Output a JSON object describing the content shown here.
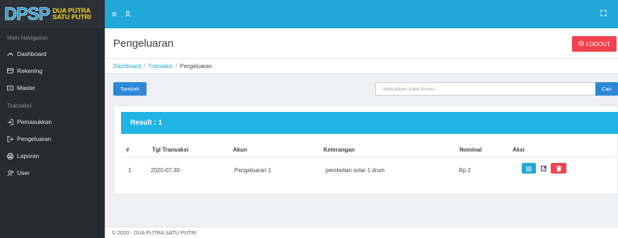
{
  "brand": {
    "logo_big": "DPSP",
    "logo_line1": "DUA PUTRA",
    "logo_line2": "SATU PUTRI"
  },
  "sidebar": {
    "header_main": "Main Navigation",
    "header_transaksi": "Transaksi",
    "items": [
      {
        "label": "Dashboard",
        "icon": "dashboard-icon"
      },
      {
        "label": "Rekening",
        "icon": "card-icon"
      },
      {
        "label": "Master",
        "icon": "folder-icon"
      },
      {
        "label": "Pemasukkan",
        "icon": "login-icon"
      },
      {
        "label": "Pengeluaran",
        "icon": "logout-icon"
      },
      {
        "label": "Laporan",
        "icon": "print-icon"
      },
      {
        "label": "User",
        "icon": "users-icon"
      }
    ]
  },
  "topbar": {
    "burger": "≡",
    "user_icon": "ꭺ",
    "expand_icon": "⛶"
  },
  "page": {
    "title": "Pengeluaran",
    "logout_label": "LOGOUT",
    "breadcrumb": [
      "Dashboard",
      "Transaksi",
      "Pengeluaran"
    ],
    "breadcrumb_sep": "/"
  },
  "toolbar": {
    "add_label": "Tambah",
    "search_placeholder": "Masukkan Kata Kunci...",
    "search_button": "Cari"
  },
  "result": {
    "title": "Result : 1",
    "columns": [
      "#",
      "Tgl Transaksi",
      "Akun",
      "Keterangan",
      "Nominal",
      "Aksi"
    ],
    "rows": [
      {
        "no": "1",
        "tgl": "2020-07-30",
        "akun": "Pengeluaran 1",
        "keterangan": "pembelian solar 1 drum",
        "nominal": "Rp 2"
      }
    ]
  },
  "footer": {
    "text": "© 2020 - DUA PUTRA SATU PUTRI"
  },
  "colors": {
    "primary": "#20a8d8",
    "danger": "#f0434f",
    "sidebar": "#262b31",
    "button_blue": "#2e88d8"
  }
}
